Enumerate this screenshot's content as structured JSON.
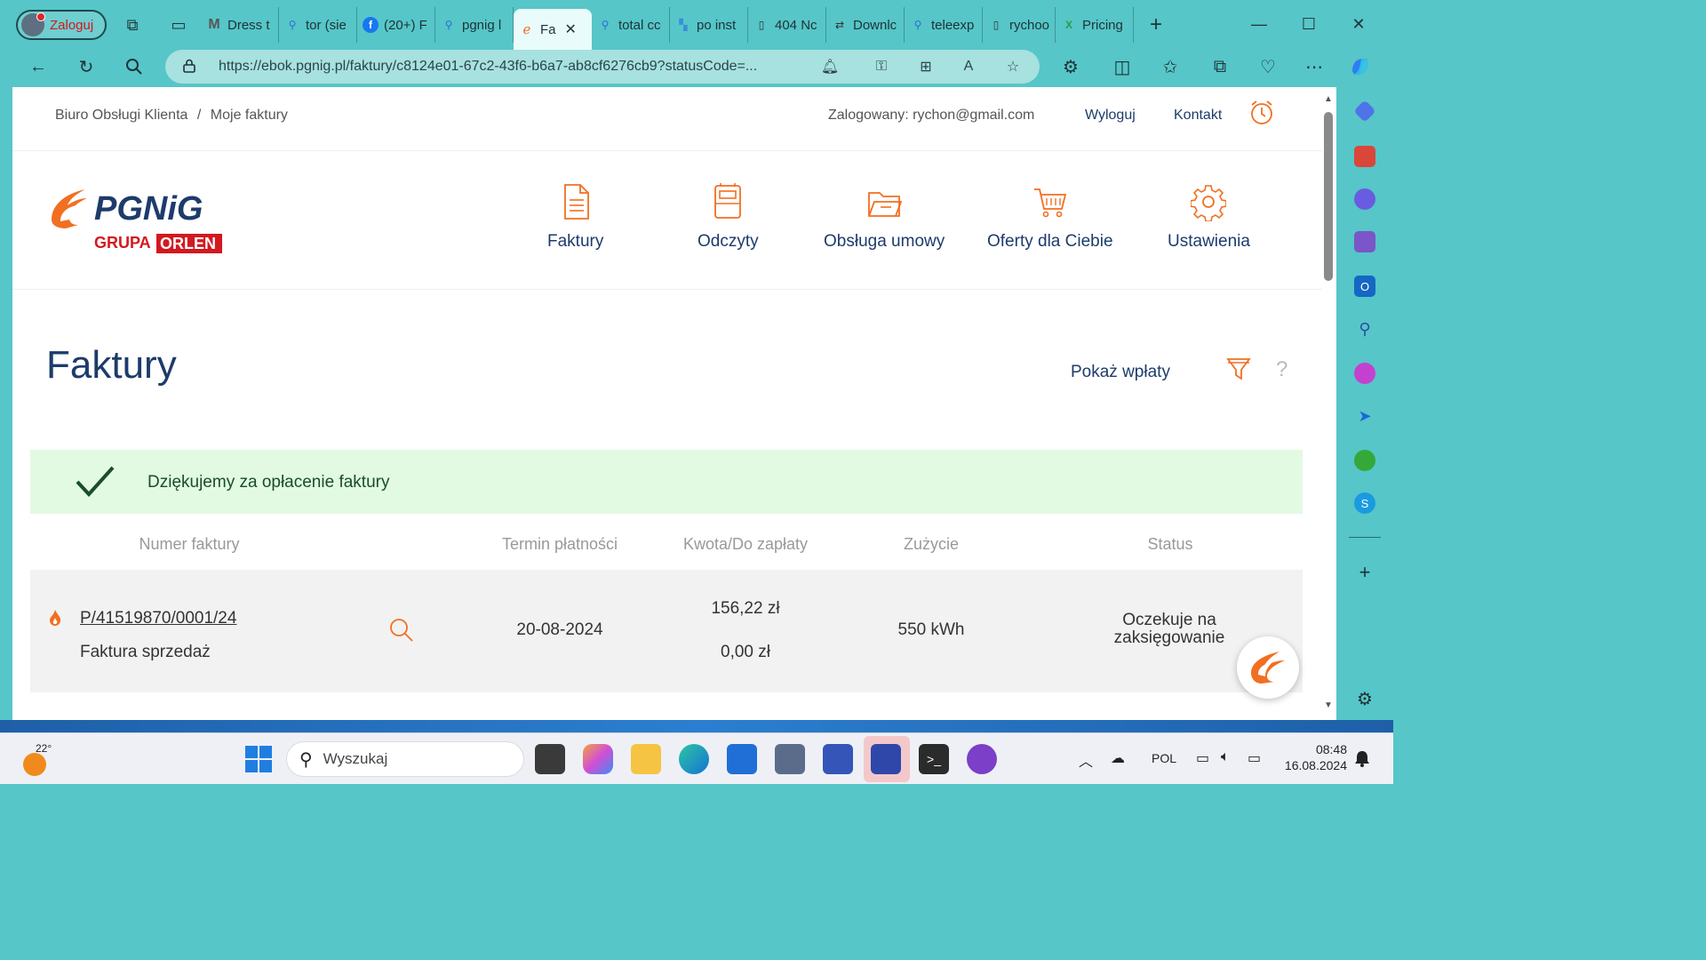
{
  "browser": {
    "profile_label": "Zaloguj",
    "tabs": [
      {
        "label": "Dress t",
        "icon": "gmail-m-icon"
      },
      {
        "label": "tor (sie",
        "icon": "search-icon"
      },
      {
        "label": "(20+) F",
        "icon": "facebook-icon"
      },
      {
        "label": "pgnig l",
        "icon": "search-icon"
      },
      {
        "label": "Fa",
        "icon": "pgnig-flame-icon",
        "active": true
      },
      {
        "label": "total cc",
        "icon": "search-icon"
      },
      {
        "label": "po inst",
        "icon": "image-icon"
      },
      {
        "label": "404 Nc",
        "icon": "page-icon"
      },
      {
        "label": "Downlc",
        "icon": "network-icon"
      },
      {
        "label": "teleexp",
        "icon": "search-icon"
      },
      {
        "label": "rychoo",
        "icon": "page-icon"
      },
      {
        "label": "Pricing",
        "icon": "xplus-icon"
      }
    ],
    "url": "https://ebok.pgnig.pl/faktury/c8124e01-67c2-43f6-b6a7-ab8cf6276cb9?statusCode=..."
  },
  "topbar": {
    "breadcrumb_home": "Biuro Obsługi Klienta",
    "breadcrumb_sep": "/",
    "breadcrumb_current": "Moje faktury",
    "user_info": "Zalogowany: rychon@gmail.com",
    "logout": "Wyloguj",
    "contact": "Kontakt"
  },
  "logo": {
    "brand": "PGNiG",
    "group": "GRUPA",
    "orlen": "ORLEN"
  },
  "menu": {
    "invoices": "Faktury",
    "readings": "Odczyty",
    "contract": "Obsługa umowy",
    "offers": "Oferty dla Ciebie",
    "settings": "Ustawienia"
  },
  "main": {
    "title": "Faktury",
    "show_payments": "Pokaż wpłaty",
    "help": "?",
    "success_message": "Dziękujemy za opłacenie faktury"
  },
  "table": {
    "headers": {
      "number": "Numer faktury",
      "due": "Termin płatności",
      "amount": "Kwota/Do zapłaty",
      "usage": "Zużycie",
      "status": "Status"
    },
    "rows": [
      {
        "number": "P/41519870/0001/24",
        "type": "Faktura sprzedaż",
        "due": "20-08-2024",
        "amount": "156,22 zł",
        "to_pay": "0,00 zł",
        "usage": "550 kWh",
        "status_line1": "Oczekuje na",
        "status_line2": "zaksięgowanie"
      }
    ]
  },
  "taskbar": {
    "temperature": "22°",
    "search_placeholder": "Wyszukaj",
    "language": "POL",
    "time": "08:48",
    "date": "16.08.2024"
  },
  "colors": {
    "accent_orange": "#f26f21",
    "navy": "#1d3b6b",
    "success_bg": "#e2fae2",
    "browser_teal": "#56c6c8"
  }
}
